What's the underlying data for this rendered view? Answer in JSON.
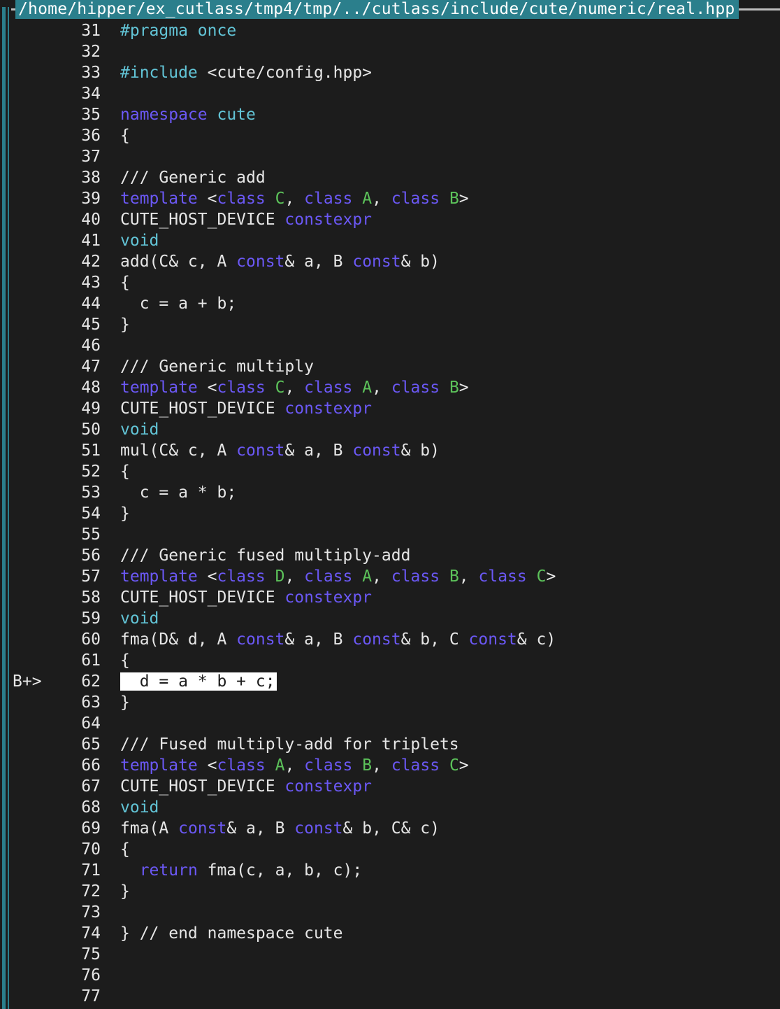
{
  "window": {
    "title": "/home/hipper/ex_cutlass/tmp4/tmp/../cutlass/include/cute/numeric/real.hpp"
  },
  "breakpoint_marker": "B+>",
  "current_line": 62,
  "colors": {
    "keyword": "#6b58f5",
    "class_name": "#5cc25a",
    "preprocessor": "#62c4d6",
    "border": "#2b7f8c",
    "background": "#1c1c1c"
  },
  "lines": [
    {
      "n": "31",
      "t": [
        [
          "pp",
          "#pragma"
        ],
        [
          "pp",
          " once"
        ]
      ]
    },
    {
      "n": "32",
      "t": []
    },
    {
      "n": "33",
      "t": [
        [
          "pp",
          "#include"
        ],
        [
          "",
          " <cute/config.hpp>"
        ]
      ]
    },
    {
      "n": "34",
      "t": []
    },
    {
      "n": "35",
      "t": [
        [
          "kw",
          "namespace"
        ],
        [
          "",
          " "
        ],
        [
          "pp",
          "cute"
        ]
      ]
    },
    {
      "n": "36",
      "t": [
        [
          "",
          "{"
        ]
      ]
    },
    {
      "n": "37",
      "t": []
    },
    {
      "n": "38",
      "t": [
        [
          "cm",
          "/// Generic add"
        ]
      ]
    },
    {
      "n": "39",
      "t": [
        [
          "kw",
          "template"
        ],
        [
          "",
          " <"
        ],
        [
          "kw",
          "class"
        ],
        [
          "",
          " "
        ],
        [
          "cls",
          "C"
        ],
        [
          "",
          ", "
        ],
        [
          "kw",
          "class"
        ],
        [
          "",
          " "
        ],
        [
          "cls",
          "A"
        ],
        [
          "",
          ", "
        ],
        [
          "kw",
          "class"
        ],
        [
          "",
          " "
        ],
        [
          "cls",
          "B"
        ],
        [
          "",
          ">"
        ]
      ]
    },
    {
      "n": "40",
      "t": [
        [
          "",
          "CUTE_HOST_DEVICE "
        ],
        [
          "kw",
          "constexpr"
        ]
      ]
    },
    {
      "n": "41",
      "t": [
        [
          "pp",
          "void"
        ]
      ]
    },
    {
      "n": "42",
      "t": [
        [
          "",
          "add(C& c, A "
        ],
        [
          "kw",
          "const"
        ],
        [
          "",
          "& a, B "
        ],
        [
          "kw",
          "const"
        ],
        [
          "",
          "& b)"
        ]
      ]
    },
    {
      "n": "43",
      "t": [
        [
          "",
          "{"
        ]
      ]
    },
    {
      "n": "44",
      "t": [
        [
          "",
          "  c = a + b;"
        ]
      ]
    },
    {
      "n": "45",
      "t": [
        [
          "",
          "}"
        ]
      ]
    },
    {
      "n": "46",
      "t": []
    },
    {
      "n": "47",
      "t": [
        [
          "cm",
          "/// Generic multiply"
        ]
      ]
    },
    {
      "n": "48",
      "t": [
        [
          "kw",
          "template"
        ],
        [
          "",
          " <"
        ],
        [
          "kw",
          "class"
        ],
        [
          "",
          " "
        ],
        [
          "cls",
          "C"
        ],
        [
          "",
          ", "
        ],
        [
          "kw",
          "class"
        ],
        [
          "",
          " "
        ],
        [
          "cls",
          "A"
        ],
        [
          "",
          ", "
        ],
        [
          "kw",
          "class"
        ],
        [
          "",
          " "
        ],
        [
          "cls",
          "B"
        ],
        [
          "",
          ">"
        ]
      ]
    },
    {
      "n": "49",
      "t": [
        [
          "",
          "CUTE_HOST_DEVICE "
        ],
        [
          "kw",
          "constexpr"
        ]
      ]
    },
    {
      "n": "50",
      "t": [
        [
          "pp",
          "void"
        ]
      ]
    },
    {
      "n": "51",
      "t": [
        [
          "",
          "mul(C& c, A "
        ],
        [
          "kw",
          "const"
        ],
        [
          "",
          "& a, B "
        ],
        [
          "kw",
          "const"
        ],
        [
          "",
          "& b)"
        ]
      ]
    },
    {
      "n": "52",
      "t": [
        [
          "",
          "{"
        ]
      ]
    },
    {
      "n": "53",
      "t": [
        [
          "",
          "  c = a * b;"
        ]
      ]
    },
    {
      "n": "54",
      "t": [
        [
          "",
          "}"
        ]
      ]
    },
    {
      "n": "55",
      "t": []
    },
    {
      "n": "56",
      "t": [
        [
          "cm",
          "/// Generic fused multiply-add"
        ]
      ]
    },
    {
      "n": "57",
      "t": [
        [
          "kw",
          "template"
        ],
        [
          "",
          " <"
        ],
        [
          "kw",
          "class"
        ],
        [
          "",
          " "
        ],
        [
          "cls",
          "D"
        ],
        [
          "",
          ", "
        ],
        [
          "kw",
          "class"
        ],
        [
          "",
          " "
        ],
        [
          "cls",
          "A"
        ],
        [
          "",
          ", "
        ],
        [
          "kw",
          "class"
        ],
        [
          "",
          " "
        ],
        [
          "cls",
          "B"
        ],
        [
          "",
          ", "
        ],
        [
          "kw",
          "class"
        ],
        [
          "",
          " "
        ],
        [
          "cls",
          "C"
        ],
        [
          "",
          ">"
        ]
      ]
    },
    {
      "n": "58",
      "t": [
        [
          "",
          "CUTE_HOST_DEVICE "
        ],
        [
          "kw",
          "constexpr"
        ]
      ]
    },
    {
      "n": "59",
      "t": [
        [
          "pp",
          "void"
        ]
      ]
    },
    {
      "n": "60",
      "t": [
        [
          "",
          "fma(D& d, A "
        ],
        [
          "kw",
          "const"
        ],
        [
          "",
          "& a, B "
        ],
        [
          "kw",
          "const"
        ],
        [
          "",
          "& b, C "
        ],
        [
          "kw",
          "const"
        ],
        [
          "",
          "& c)"
        ]
      ]
    },
    {
      "n": "61",
      "t": [
        [
          "",
          "{"
        ]
      ]
    },
    {
      "n": "62",
      "t": [
        [
          "cur",
          "  d = a * b + c;"
        ]
      ],
      "bp": true
    },
    {
      "n": "63",
      "t": [
        [
          "",
          "}"
        ]
      ]
    },
    {
      "n": "64",
      "t": []
    },
    {
      "n": "65",
      "t": [
        [
          "cm",
          "/// Fused multiply-add for triplets"
        ]
      ]
    },
    {
      "n": "66",
      "t": [
        [
          "kw",
          "template"
        ],
        [
          "",
          " <"
        ],
        [
          "kw",
          "class"
        ],
        [
          "",
          " "
        ],
        [
          "cls",
          "A"
        ],
        [
          "",
          ", "
        ],
        [
          "kw",
          "class"
        ],
        [
          "",
          " "
        ],
        [
          "cls",
          "B"
        ],
        [
          "",
          ", "
        ],
        [
          "kw",
          "class"
        ],
        [
          "",
          " "
        ],
        [
          "cls",
          "C"
        ],
        [
          "",
          ">"
        ]
      ]
    },
    {
      "n": "67",
      "t": [
        [
          "",
          "CUTE_HOST_DEVICE "
        ],
        [
          "kw",
          "constexpr"
        ]
      ]
    },
    {
      "n": "68",
      "t": [
        [
          "pp",
          "void"
        ]
      ]
    },
    {
      "n": "69",
      "t": [
        [
          "",
          "fma(A "
        ],
        [
          "kw",
          "const"
        ],
        [
          "",
          "& a, B "
        ],
        [
          "kw",
          "const"
        ],
        [
          "",
          "& b, C& c)"
        ]
      ]
    },
    {
      "n": "70",
      "t": [
        [
          "",
          "{"
        ]
      ]
    },
    {
      "n": "71",
      "t": [
        [
          "",
          "  "
        ],
        [
          "kw",
          "return"
        ],
        [
          "",
          " fma(c, a, b, c);"
        ]
      ]
    },
    {
      "n": "72",
      "t": [
        [
          "",
          "}"
        ]
      ]
    },
    {
      "n": "73",
      "t": []
    },
    {
      "n": "74",
      "t": [
        [
          "",
          "} // end namespace cute"
        ]
      ]
    },
    {
      "n": "75",
      "t": []
    },
    {
      "n": "76",
      "t": []
    },
    {
      "n": "77",
      "t": []
    }
  ]
}
